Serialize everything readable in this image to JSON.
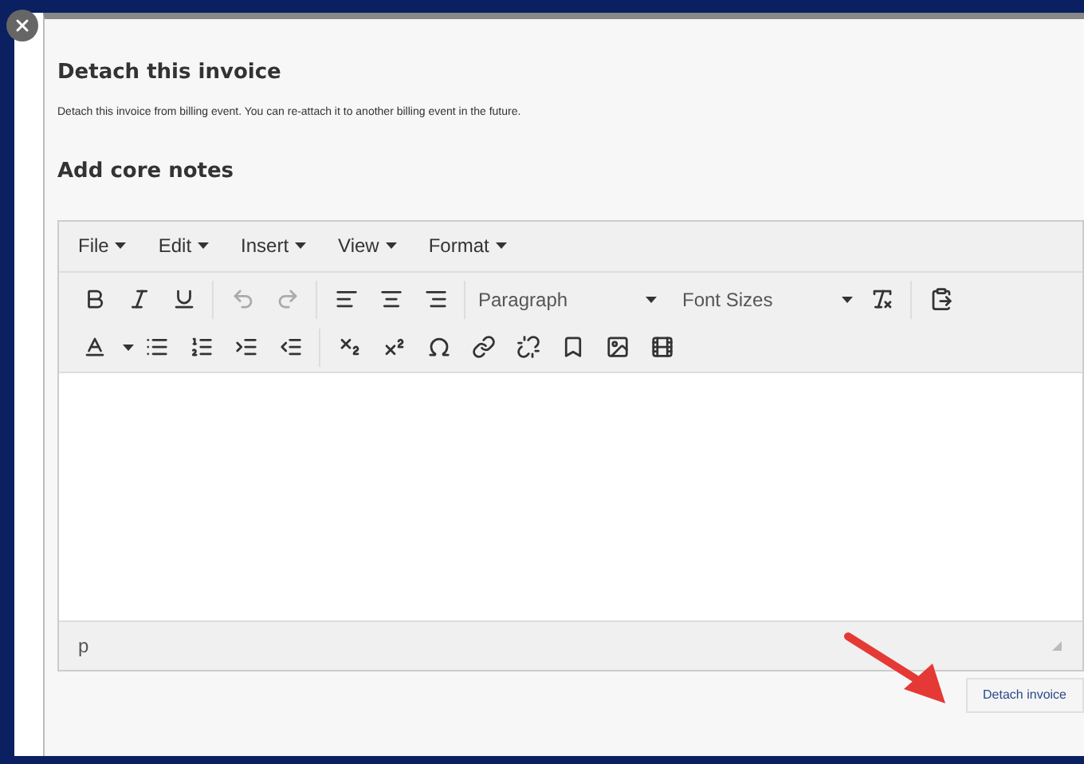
{
  "dialog": {
    "title": "Detach this invoice",
    "description": "Detach this invoice from billing event. You can re-attach it to another billing event in the future.",
    "section_title": "Add core notes"
  },
  "editor": {
    "menus": [
      "File",
      "Edit",
      "Insert",
      "View",
      "Format"
    ],
    "block_format": "Paragraph",
    "font_size": "Font Sizes",
    "status_path": "p"
  },
  "buttons": [
    {
      "label": "Detach invoice"
    }
  ]
}
